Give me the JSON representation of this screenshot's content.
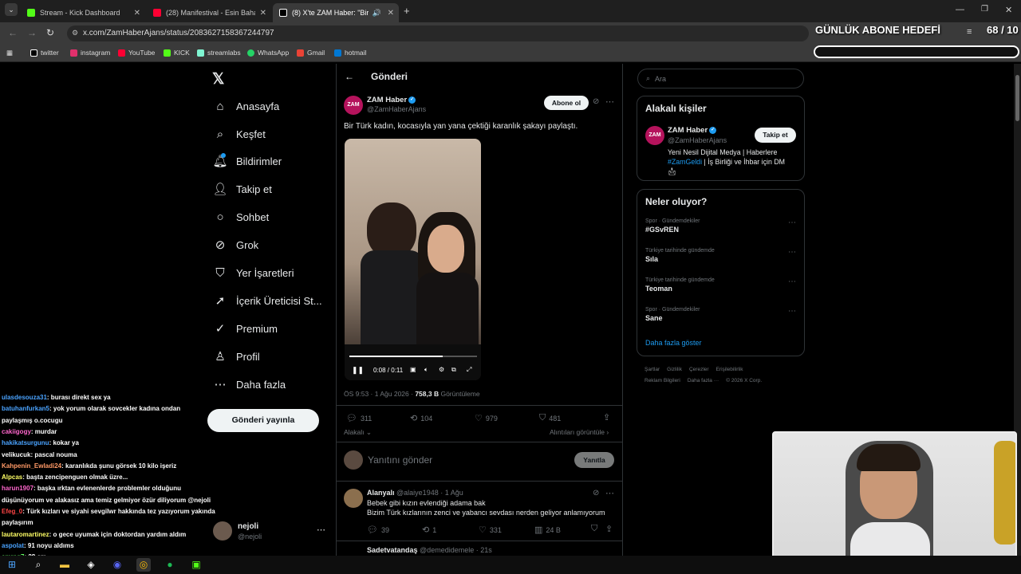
{
  "browser": {
    "tabs": [
      {
        "label": "Stream - Kick Dashboard",
        "color": "#53fc18"
      },
      {
        "label": "(28) Manifestival - Esin Bahat In",
        "color": "#ff0033"
      },
      {
        "label": "(8) X'te ZAM Haber: \"Bir Tü",
        "color": "#ffffff"
      }
    ],
    "url": "x.com/ZamHaberAjans/status/2083627158367244797",
    "bookmarks": [
      "twitter",
      "instagram",
      "YouTube",
      "KICK",
      "streamlabs",
      "WhatsApp",
      "Gmail",
      "hotmail"
    ]
  },
  "overlay": {
    "goal_title": "GÜNLÜK ABONE HEDEFİ",
    "goal_count": "68 / 10"
  },
  "nav": {
    "items": [
      "Anasayfa",
      "Keşfet",
      "Bildirimler",
      "Takip et",
      "Sohbet",
      "Grok",
      "Yer İşaretleri",
      "İçerik Üreticisi St...",
      "Premium",
      "Profil",
      "Daha fazla"
    ],
    "post_button": "Gönderi yayınla",
    "account_name": "nejoli",
    "account_handle": "@nejoli"
  },
  "post": {
    "header": "Gönderi",
    "author_name": "ZAM Haber",
    "author_handle": "@ZamHaberAjans",
    "avatar_text": "ZAM",
    "subscribe_label": "Abone ol",
    "text": "Bir Türk kadın, kocasıyla yan yana çektiği karanlık şakayı paylaştı.",
    "video_time": "0:08 / 0:11",
    "video_progress": 0.73,
    "meta_time": "ÖS 9:53 · 1 Ağu 2026 · ",
    "meta_views": "758,3 B",
    "meta_views_label": " Görüntüleme",
    "stats": {
      "replies": "311",
      "reposts": "104",
      "likes": "979",
      "bookmarks": "481"
    },
    "sort_label": "Alakalı",
    "quotes_label": "Alıntıları görüntüle",
    "reply_placeholder": "Yanıtını gönder",
    "reply_button": "Yanıtla"
  },
  "replies": [
    {
      "name": "Alanyalı",
      "handle": "@alaiye1948 · 1 Ağu",
      "line1": "Bebek gibi kızın evlendiği adama bak",
      "line2": "Bizim Türk kızlarının zenci ve yabancı sevdası nerden geliyor anlamıyorum",
      "stats": {
        "replies": "39",
        "reposts": "1",
        "likes": "331",
        "views": "24 B"
      }
    },
    {
      "name": "Sadetvatandaş",
      "handle": "@demedidemele · 21s"
    }
  ],
  "right": {
    "search_placeholder": "Ara",
    "relevant_title": "Alakalı kişiler",
    "relevant_name": "ZAM Haber",
    "relevant_handle": "@ZamHaberAjans",
    "follow_label": "Takip et",
    "bio_line1": "Yeni Nesil Dijital Medya | Haberlere",
    "bio_tag": "#ZamGeldi",
    "bio_line2_rest": " | İş Birliği ve İhbar için DM",
    "trends_title": "Neler oluyor?",
    "trends": [
      {
        "category": "Spor · Gündemdekiler",
        "name": "#GSvREN"
      },
      {
        "category": "Türkiye tarihinde gündemde",
        "name": "Sıla"
      },
      {
        "category": "Türkiye tarihinde gündemde",
        "name": "Teoman"
      },
      {
        "category": "Spor · Gündemdekiler",
        "name": "Sane"
      }
    ],
    "show_more": "Daha fazla göster",
    "footer1": "Şartlar     Gizlilik     Çerezler     Erişilebilirlik",
    "footer2": "Reklam Bilgileri     Daha fazla ···     © 2026 X Corp."
  },
  "chat": [
    {
      "user": "ulasdesouza31",
      "color": "#4aa3ff",
      "msg": ": burası direkt sex ya"
    },
    {
      "user": "batuhanfurkan5",
      "color": "#4aa3ff",
      "msg": ": yok yorum olarak sovcekler kadına ondan"
    },
    {
      "user": "",
      "color": "#ffffff",
      "msg": "paylaşmış o.cocugu"
    },
    {
      "user": "cakiigogy",
      "color": "#ff66cc",
      "msg": ": murdar"
    },
    {
      "user": "hakikatsurgunu",
      "color": "#4aa3ff",
      "msg": ": kokar ya"
    },
    {
      "user": "velikucuk",
      "color": "#ffffff",
      "msg": ": pascal nouma"
    },
    {
      "user": "Kahpenin_Ewladi24",
      "color": "#ff9966",
      "msg": ": karanlıkda şunu görsek 10 kilo işeriz"
    },
    {
      "user": "Alpcas",
      "color": "#ffff66",
      "msg": ": başta zencipenguen olmak üzre..."
    },
    {
      "user": "harun1907",
      "color": "#ff66cc",
      "msg": ": başka ırktan evlenenlerde problemler olduğunu"
    },
    {
      "user": "",
      "color": "#ffffff",
      "msg": "düşünüyorum ve alakasız ama temiz gelmiyor özür diliyorum @nejoli"
    },
    {
      "user": "Efeg_0",
      "color": "#ff4444",
      "msg": ": Türk kızları ve siyahi sevgilwr hakkında tez yazıyorum yakında"
    },
    {
      "user": "",
      "color": "#ffffff",
      "msg": "paylaşırım"
    },
    {
      "user": "lautaromartinez",
      "color": "#ffff66",
      "msg": ": o gece uyumak için doktordan yardım aldım"
    },
    {
      "user": "aspolat",
      "color": "#4aa3ff",
      "msg": ": 91 noyu aldıms"
    },
    {
      "user": "emreg7",
      "color": "#66ff66",
      "msg": ": 28 cm"
    }
  ]
}
